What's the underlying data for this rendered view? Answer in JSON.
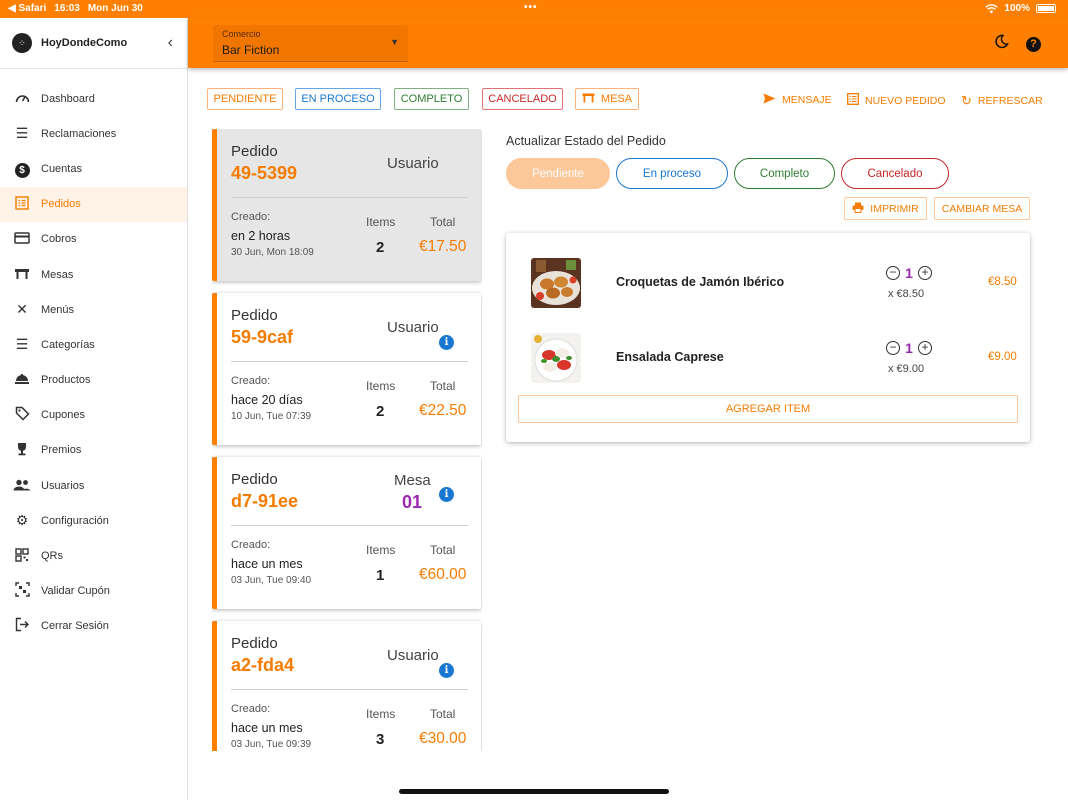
{
  "status_bar": {
    "browser": "◀ Safari",
    "time": "16:03",
    "date": "Mon Jun 30",
    "battery": "100%"
  },
  "brand": {
    "name": "HoyDondeComo"
  },
  "sidebar": {
    "items": [
      {
        "label": "Dashboard",
        "icon": "speedometer-icon"
      },
      {
        "label": "Reclamaciones",
        "icon": "list-icon"
      },
      {
        "label": "Cuentas",
        "icon": "dollar-icon"
      },
      {
        "label": "Pedidos",
        "icon": "receipt-icon",
        "active": true
      },
      {
        "label": "Cobros",
        "icon": "credit-card-icon"
      },
      {
        "label": "Mesas",
        "icon": "table-icon"
      },
      {
        "label": "Menús",
        "icon": "utensils-icon"
      },
      {
        "label": "Categorías",
        "icon": "list-icon"
      },
      {
        "label": "Productos",
        "icon": "food-icon"
      },
      {
        "label": "Cupones",
        "icon": "tag-icon"
      },
      {
        "label": "Premios",
        "icon": "trophy-icon"
      },
      {
        "label": "Usuarios",
        "icon": "users-icon"
      },
      {
        "label": "Configuración",
        "icon": "gear-icon"
      },
      {
        "label": "QRs",
        "icon": "qr-icon"
      },
      {
        "label": "Validar Cupón",
        "icon": "qr-scan-icon"
      },
      {
        "label": "Cerrar Sesión",
        "icon": "logout-icon"
      }
    ]
  },
  "topbar": {
    "select_label": "Comercio",
    "select_value": "Bar Fiction"
  },
  "filters": {
    "pendiente": "PENDIENTE",
    "en_proceso": "EN PROCESO",
    "completo": "COMPLETO",
    "cancelado": "CANCELADO",
    "mesa": "MESA"
  },
  "actions": {
    "mensaje": "MENSAJE",
    "nuevo_pedido": "NUEVO PEDIDO",
    "refrescar": "REFRESCAR"
  },
  "orders": [
    {
      "label": "Pedido",
      "id": "49-5399",
      "who": "Usuario",
      "created_label": "Creado:",
      "relative": "en 2 horas",
      "date": "30 Jun, Mon 18:09",
      "items_label": "Items",
      "items": "2",
      "total_label": "Total",
      "total": "€17.50"
    },
    {
      "label": "Pedido",
      "id": "59-9caf",
      "who": "Usuario",
      "created_label": "Creado:",
      "relative": "hace 20 días",
      "date": "10 Jun, Tue 07:39",
      "items_label": "Items",
      "items": "2",
      "total_label": "Total",
      "total": "€22.50"
    },
    {
      "label": "Pedido",
      "id": "d7-91ee",
      "who": "Mesa",
      "mesa": "01",
      "created_label": "Creado:",
      "relative": "hace un mes",
      "date": "03 Jun, Tue 09:40",
      "items_label": "Items",
      "items": "1",
      "total_label": "Total",
      "total": "€60.00"
    },
    {
      "label": "Pedido",
      "id": "a2-fda4",
      "who": "Usuario",
      "created_label": "Creado:",
      "relative": "hace un mes",
      "date": "03 Jun, Tue 09:39",
      "items_label": "Items",
      "items": "3",
      "total_label": "Total",
      "total": "€30.00"
    }
  ],
  "detail": {
    "title": "Actualizar Estado del Pedido",
    "status_buttons": {
      "pendiente": "Pendiente",
      "en_proceso": "En proceso",
      "completo": "Completo",
      "cancelado": "Cancelado"
    },
    "imprimir": "IMPRIMIR",
    "cambiar_mesa": "CAMBIAR MESA",
    "items": [
      {
        "name": "Croquetas de Jamón Ibérico",
        "qty": "1",
        "unit": "x €8.50",
        "total": "€8.50"
      },
      {
        "name": "Ensalada Caprese",
        "qty": "1",
        "unit": "x €9.00",
        "total": "€9.00"
      }
    ],
    "add_item": "AGREGAR ITEM"
  },
  "colors": {
    "brand": "#ff8000",
    "accent": "#f57c00",
    "purple": "#9c27b0",
    "info": "#1976d2"
  }
}
